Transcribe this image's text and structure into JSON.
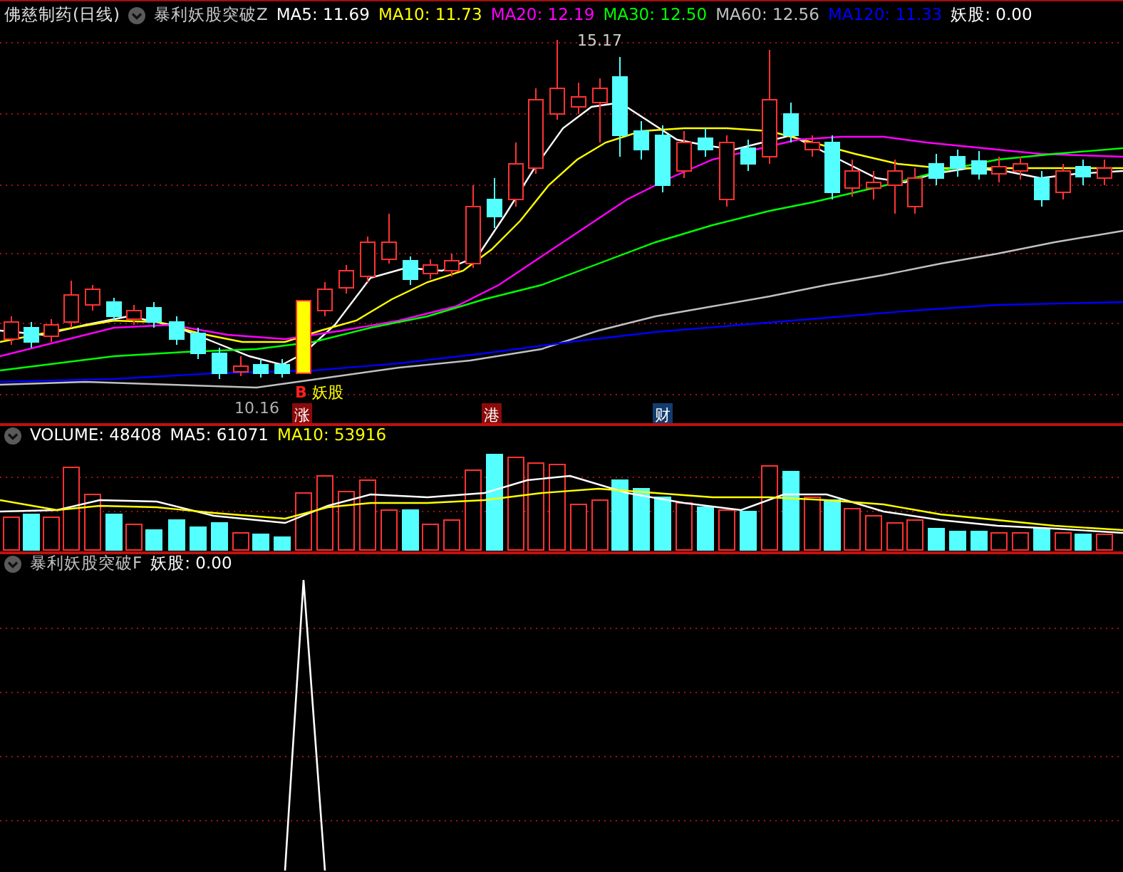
{
  "main_panel": {
    "stock_title": "佛慈制药(日线)",
    "indicator_name": "暴利妖股突破Z",
    "legend": [
      {
        "text": "MA5: 11.69",
        "color": "#ffffff"
      },
      {
        "text": "MA10: 11.73",
        "color": "#ffff00"
      },
      {
        "text": "MA20: 12.19",
        "color": "#ff00ff"
      },
      {
        "text": "MA30: 12.50",
        "color": "#00ff00"
      },
      {
        "text": "MA60: 12.56",
        "color": "#c0c0c0"
      },
      {
        "text": "MA120: 11.33",
        "color": "#0000ff"
      },
      {
        "text": "妖股: 0.00",
        "color": "#ffffff"
      }
    ],
    "high_label": "15.17",
    "low_label": "10.16",
    "signal_label": "B",
    "signal_text": "妖股",
    "event_markers": [
      {
        "text": "涨",
        "color": "#8b0a0a"
      },
      {
        "text": "港",
        "color": "#8b0a0a"
      },
      {
        "text": "财",
        "color": "#123c6e"
      }
    ]
  },
  "volume_panel": {
    "legend": [
      {
        "text": "VOLUME: 48408",
        "color": "#ffffff"
      },
      {
        "text": "MA5: 61071",
        "color": "#ffffff"
      },
      {
        "text": "MA10: 53916",
        "color": "#ffff00"
      }
    ]
  },
  "signal_panel": {
    "legend": [
      {
        "text": "暴利妖股突破F",
        "color": "#c0c0c0"
      },
      {
        "text": "妖股: 0.00",
        "color": "#ffffff"
      }
    ]
  }
}
